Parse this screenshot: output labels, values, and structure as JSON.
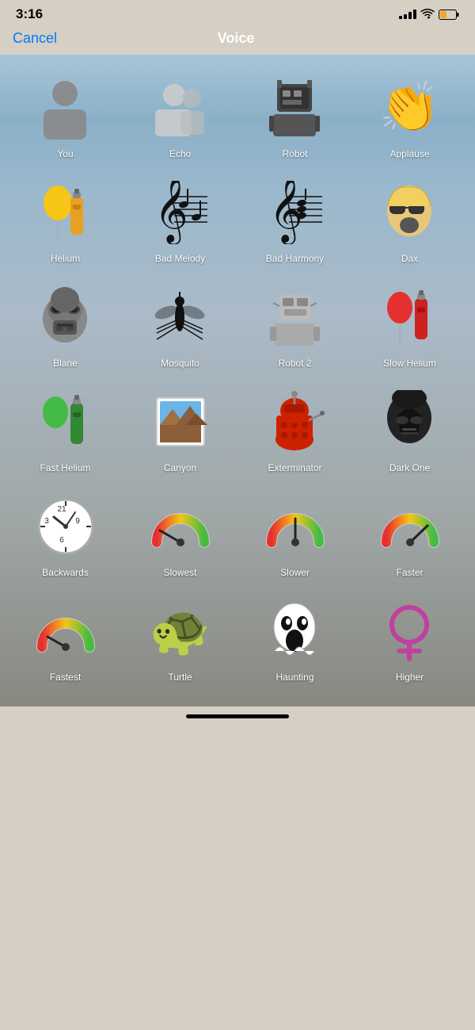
{
  "statusBar": {
    "time": "3:16",
    "signalBars": [
      3,
      4,
      5,
      6,
      7
    ],
    "wifi": true,
    "battery": "low"
  },
  "navBar": {
    "cancelLabel": "Cancel",
    "title": "Voice"
  },
  "voiceItems": [
    {
      "id": "you",
      "label": "You",
      "icon": "person"
    },
    {
      "id": "echo",
      "label": "Echo",
      "icon": "echo"
    },
    {
      "id": "robot",
      "label": "Robot",
      "icon": "robot"
    },
    {
      "id": "applause",
      "label": "Applause",
      "icon": "applause"
    },
    {
      "id": "helium",
      "label": "Helium",
      "icon": "helium"
    },
    {
      "id": "bad-melody",
      "label": "Bad Melody",
      "icon": "bad-melody"
    },
    {
      "id": "bad-harmony",
      "label": "Bad Harmony",
      "icon": "bad-harmony"
    },
    {
      "id": "dax",
      "label": "Dax",
      "icon": "dax"
    },
    {
      "id": "blane",
      "label": "Blane",
      "icon": "blane"
    },
    {
      "id": "mosquito",
      "label": "Mosquito",
      "icon": "mosquito"
    },
    {
      "id": "robot2",
      "label": "Robot 2",
      "icon": "robot2"
    },
    {
      "id": "slow-helium",
      "label": "Slow Helium",
      "icon": "slow-helium"
    },
    {
      "id": "fast-helium",
      "label": "Fast Helium",
      "icon": "fast-helium"
    },
    {
      "id": "canyon",
      "label": "Canyon",
      "icon": "canyon"
    },
    {
      "id": "exterminator",
      "label": "Exterminator",
      "icon": "exterminator"
    },
    {
      "id": "dark-one",
      "label": "Dark One",
      "icon": "dark-one"
    },
    {
      "id": "backwards",
      "label": "Backwards",
      "icon": "backwards"
    },
    {
      "id": "slowest",
      "label": "Slowest",
      "icon": "slowest"
    },
    {
      "id": "slower",
      "label": "Slower",
      "icon": "slower"
    },
    {
      "id": "faster",
      "label": "Faster",
      "icon": "faster"
    },
    {
      "id": "fastest",
      "label": "Fastest",
      "icon": "fastest"
    },
    {
      "id": "turtle",
      "label": "Turtle",
      "icon": "turtle"
    },
    {
      "id": "haunting",
      "label": "Haunting",
      "icon": "haunting"
    },
    {
      "id": "higher",
      "label": "Higher",
      "icon": "higher"
    }
  ],
  "homeIndicator": true
}
